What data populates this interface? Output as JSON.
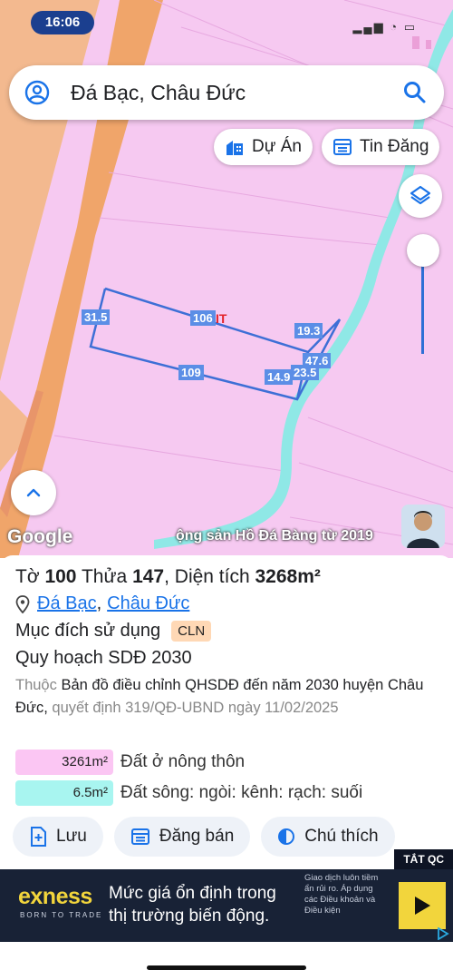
{
  "status_bar": {
    "time": "16:06"
  },
  "search": {
    "query": "Đá Bạc, Châu Đức"
  },
  "chips": {
    "projects": "Dự Án",
    "listings": "Tin Đăng"
  },
  "map": {
    "google_logo": "Google",
    "watermark": "ộng sản Hồ Đá Bàng từ 2019",
    "plot_code": "IT",
    "edge_labels": {
      "left": "31.5",
      "top": "106",
      "bottom": "109",
      "right_a": "19.3",
      "right_b": "47.6",
      "right_c": "23.5",
      "right_d": "14.9"
    }
  },
  "info": {
    "title_prefix": "Tờ",
    "sheet": "100",
    "title_mid": "Thửa",
    "parcel": "147",
    "title_area_label": ", Diện tích",
    "area": "3268m²",
    "location_1": "Đá Bạc",
    "location_sep": ",",
    "location_2": "Châu Đức",
    "purpose_label": "Mục đích sử dụng",
    "purpose_code": "CLN",
    "plan": "Quy hoạch SDĐ 2030",
    "desc_prefix": "Thuộc",
    "desc_main": "Bản đồ điều chỉnh QHSDĐ đến năm 2030 huyện Châu Đức,",
    "desc_decision": "quyết định 319/QĐ-UBND ngày 11/02/2025",
    "legend": [
      {
        "value": "3261m²",
        "label": "Đất ở nông thôn",
        "color": "#fbc6f3"
      },
      {
        "value": "6.5m²",
        "label": "Đất sông: ngòi: kênh: rạch: suối",
        "color": "#a8f5f0"
      }
    ],
    "actions": {
      "save": "Lưu",
      "post": "Đăng bán",
      "legend_note": "Chú thích"
    }
  },
  "ad": {
    "close": "TẮT QC",
    "brand": "exness",
    "tagline": "BORN TO TRADE",
    "headline": "Mức giá ổn định trong thị trường biến động.",
    "fine_print": "Giao dịch luôn tiềm ẩn rủi ro. Áp dụng các Điều khoản và Điều kiện"
  },
  "colors": {
    "land": "#f6c9f1",
    "road": "#f0b585",
    "water": "#8fe8e6",
    "plot_line": "#3d6fd6",
    "link": "#1a73e8"
  }
}
